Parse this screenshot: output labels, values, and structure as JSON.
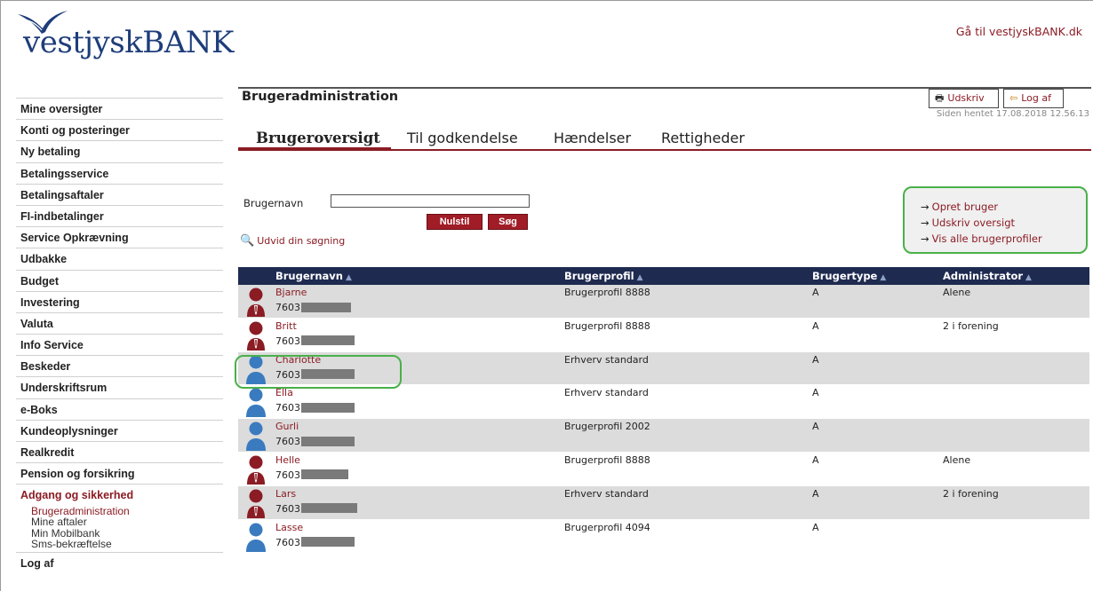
{
  "brand": {
    "name": "vestjyskBANK",
    "goto_link": "Gå til vestjyskBANK.dk",
    "color": "#1e3d7a"
  },
  "accent_color": "#8b1c24",
  "sidebar": {
    "items": [
      {
        "label": "Mine oversigter"
      },
      {
        "label": "Konti og posteringer"
      },
      {
        "label": "Ny betaling"
      },
      {
        "label": "Betalingsservice"
      },
      {
        "label": "Betalingsaftaler"
      },
      {
        "label": "FI-indbetalinger"
      },
      {
        "label": "Service Opkrævning"
      },
      {
        "label": "Udbakke"
      },
      {
        "label": "Budget"
      },
      {
        "label": "Investering"
      },
      {
        "label": "Valuta"
      },
      {
        "label": "Info Service"
      },
      {
        "label": "Beskeder"
      },
      {
        "label": "Underskriftsrum"
      },
      {
        "label": "e-Boks"
      },
      {
        "label": "Kundeoplysninger"
      },
      {
        "label": "Realkredit"
      },
      {
        "label": "Pension og forsikring"
      },
      {
        "label": "Adgang og sikkerhed"
      }
    ],
    "subitems": [
      "Brugeradministration",
      "Mine aftaler",
      "Min Mobilbank",
      "Sms-bekræftelse"
    ],
    "logout": "Log af"
  },
  "main": {
    "title": "Brugeradministration",
    "print_label": "Udskriv",
    "logout_label": "Log af",
    "fetched": "Siden hentet 17.08.2018 12.56.13",
    "tabs": [
      "Brugeroversigt",
      "Til godkendelse",
      "Hændelser",
      "Rettigheder"
    ],
    "search": {
      "label": "Brugernavn",
      "value": "",
      "reset": "Nulstil",
      "submit": "Søg",
      "expand": "Udvid din søgning"
    },
    "actions": [
      "Opret bruger",
      "Udskriv oversigt",
      "Vis alle brugerprofiler"
    ],
    "table": {
      "headers": [
        "Brugernavn",
        "Brugerprofil",
        "Brugertype",
        "Administrator"
      ],
      "rows": [
        {
          "name": "Bjarne",
          "id": "7603",
          "profile": "Brugerprofil 8888",
          "type": "A",
          "admin": "Alene",
          "avatar": "red",
          "mask": 0.8
        },
        {
          "name": "Britt",
          "id": "7603",
          "profile": "Brugerprofil 8888",
          "type": "A",
          "admin": "2 i forening",
          "avatar": "red",
          "mask": 0.85
        },
        {
          "name": "Charlotte",
          "id": "7603",
          "profile": "Erhverv standard",
          "type": "A",
          "admin": "",
          "avatar": "blue",
          "mask": 0.85
        },
        {
          "name": "Ella",
          "id": "7603",
          "profile": "Erhverv standard",
          "type": "A",
          "admin": "",
          "avatar": "blue",
          "mask": 0.85
        },
        {
          "name": "Gurli",
          "id": "7603",
          "profile": "Brugerprofil 2002",
          "type": "A",
          "admin": "",
          "avatar": "blue",
          "mask": 0.85
        },
        {
          "name": "Helle",
          "id": "7603",
          "profile": "Brugerprofil 8888",
          "type": "A",
          "admin": "Alene",
          "avatar": "red",
          "mask": 0.75
        },
        {
          "name": "Lars",
          "id": "7603",
          "profile": "Erhverv standard",
          "type": "A",
          "admin": "2 i forening",
          "avatar": "red",
          "mask": 0.9
        },
        {
          "name": "Lasse",
          "id": "7603",
          "profile": "Brugerprofil 4094",
          "type": "A",
          "admin": "",
          "avatar": "blue",
          "mask": 0.85
        }
      ]
    }
  }
}
